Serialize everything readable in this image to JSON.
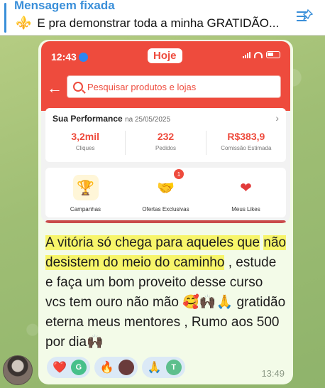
{
  "pinned": {
    "title": "Mensagem fixada",
    "text": "E pra demonstrar toda a minha GRATIDÃO...",
    "emoji": "⚜️",
    "icon": "pinned-list-icon"
  },
  "screenshot": {
    "status_time": "12:43",
    "header_label": "Hoje",
    "search_placeholder": "Pesquisar produtos e lojas",
    "performance": {
      "title": "Sua Performance",
      "date": "na 25/05/2025",
      "stats": [
        {
          "value": "3,2mil",
          "label": "Cliques"
        },
        {
          "value": "232",
          "label": "Pedidos"
        },
        {
          "value": "R$383,9",
          "label": "Comissão Estimada"
        }
      ]
    },
    "menu": [
      {
        "label": "Campanhas",
        "icon": "trophy-icon"
      },
      {
        "label": "Ofertas Exclusivas",
        "icon": "handshake-icon",
        "badge": "1"
      },
      {
        "label": "Meus Likes",
        "icon": "heart-icon"
      }
    ]
  },
  "message": {
    "highlight1": "A vitória só chega para aqueles que",
    "highlight2": "não desistem do meio do caminho",
    "rest1": " , estude e faça um bom proveito desse curso vcs tem ouro não mão ",
    "emojis1": "🥰🙌🏿🙏",
    "rest2": " gratidão eterna meus mentores , Rumo aos 500 por dia",
    "emojis2": "🙌🏿",
    "time": "13:49"
  },
  "reactions": [
    {
      "emoji": "❤️",
      "avatar": "G",
      "color": "#46c08a"
    },
    {
      "emoji": "🔥",
      "avatar": "",
      "color": "#6a3b3b"
    },
    {
      "emoji": "🙏",
      "avatar": "T",
      "color": "#5dbf8c"
    }
  ]
}
